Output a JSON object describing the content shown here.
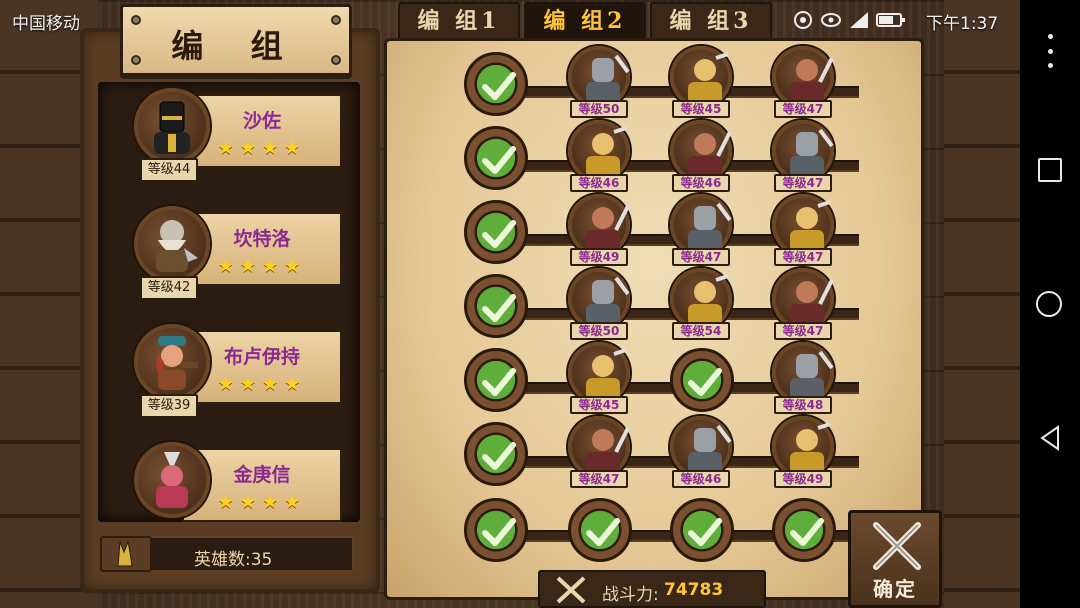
{
  "status_bar": {
    "carrier": "中国移动",
    "time": "下午1:37"
  },
  "title": "编 组",
  "tabs": [
    {
      "label": "编 组1",
      "active": false
    },
    {
      "label": "编 组2",
      "active": true
    },
    {
      "label": "编 组3",
      "active": false
    }
  ],
  "heroes": [
    {
      "name": "沙佐",
      "level": "等级44",
      "stars": "★★★★",
      "icon": "knight-icon"
    },
    {
      "name": "坎特洛",
      "level": "等级42",
      "stars": "★★★★",
      "icon": "dwarf-icon"
    },
    {
      "name": "布卢伊持",
      "level": "等级39",
      "stars": "★★★★",
      "icon": "pirate-icon"
    },
    {
      "name": "金庚信",
      "level": "",
      "stars": "★★★★",
      "icon": "samurai-icon"
    }
  ],
  "hero_count": "英雄数:35",
  "lineup": [
    [
      "等级50",
      "等级45",
      "等级47"
    ],
    [
      "等级46",
      "等级46",
      "等级47"
    ],
    [
      "等级49",
      "等级47",
      "等级47"
    ],
    [
      "等级50",
      "等级54",
      "等级47"
    ],
    [
      "等级45",
      null,
      "等级48"
    ],
    [
      "等级47",
      "等级46",
      "等级49"
    ],
    [
      null,
      null,
      null
    ]
  ],
  "power": {
    "label": "战斗力:",
    "value": "74783"
  },
  "confirm_label": "确定",
  "colors": {
    "accent": "#ffc43a",
    "name": "#8a2a90",
    "check": "#5fae3a",
    "star": "#ffd21f"
  }
}
